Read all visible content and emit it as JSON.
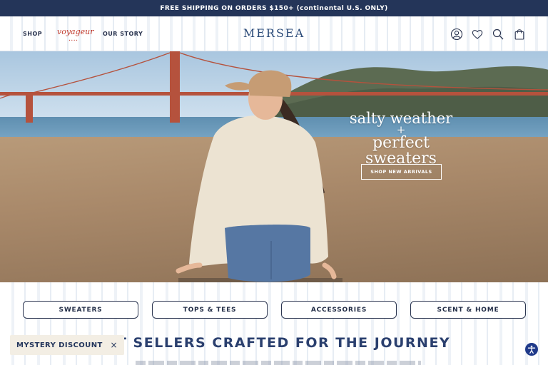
{
  "announcement": "FREE SHIPPING ON ORDERS $150+ (continental U.S. ONLY)",
  "header": {
    "nav": {
      "shop": "SHOP",
      "voyageur": "voyageur",
      "voyageur_sub": "••••",
      "our_story": "OUR STORY"
    },
    "logo": "MERSEA",
    "icons": [
      "account-icon",
      "wishlist-heart-icon",
      "search-icon",
      "shopping-bag-icon"
    ]
  },
  "hero": {
    "title_line1": "salty weather",
    "title_plus": "+",
    "title_line2": "perfect sweaters",
    "cta": "SHOP NEW ARRIVALS"
  },
  "categories": [
    "SWEATERS",
    "TOPS & TEES",
    "ACCESSORIES",
    "SCENT & HOME"
  ],
  "section": {
    "title": "ST SELLERS CRAFTED FOR THE JOURNEY"
  },
  "popup": {
    "label": "MYSTERY DISCOUNT",
    "close": "×"
  },
  "colors": {
    "navy": "#243559",
    "brand_blue": "#2a4a78",
    "accent_red": "#c0392b",
    "a11y_blue": "#1f3a8a"
  }
}
